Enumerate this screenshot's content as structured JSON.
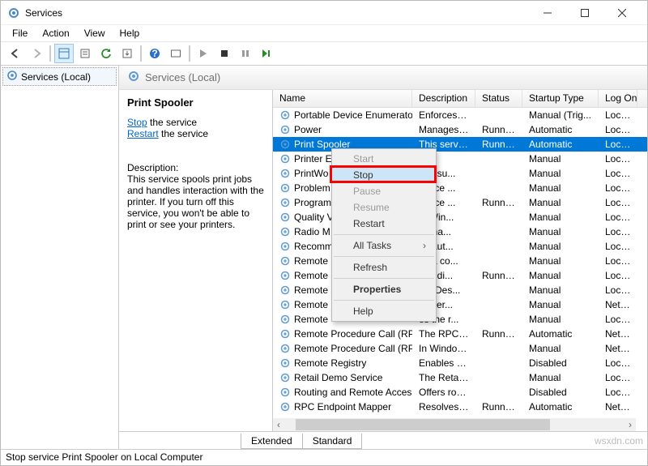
{
  "window": {
    "title": "Services"
  },
  "menu": {
    "items": [
      "File",
      "Action",
      "View",
      "Help"
    ]
  },
  "nav": {
    "label": "Services (Local)"
  },
  "content_header": {
    "title": "Services (Local)"
  },
  "detail": {
    "name": "Print Spooler",
    "stop_label": "Stop",
    "stop_suffix": " the service",
    "restart_label": "Restart",
    "restart_suffix": " the service",
    "desc_label": "Description:",
    "desc_text": "This service spools print jobs and handles interaction with the printer. If you turn off this service, you won't be able to print or see your printers."
  },
  "columns": [
    "Name",
    "Description",
    "Status",
    "Startup Type",
    "Log On"
  ],
  "rows": [
    {
      "name": "Portable Device Enumerator...",
      "desc": "Enforces gr...",
      "status": "",
      "startup": "Manual (Trig...",
      "logon": "Local Sy"
    },
    {
      "name": "Power",
      "desc": "Manages p...",
      "status": "Running",
      "startup": "Automatic",
      "logon": "Local Sy"
    },
    {
      "name": "Print Spooler",
      "desc": "This service ...",
      "status": "Running",
      "startup": "Automatic",
      "logon": "Local Sy",
      "selected": true
    },
    {
      "name": "Printer E",
      "desc": "",
      "status": "",
      "startup": "Manual",
      "logon": "Local Sy"
    },
    {
      "name": "PrintWo",
      "desc": "des su...",
      "status": "",
      "startup": "Manual",
      "logon": "Local Sy"
    },
    {
      "name": "Problem",
      "desc": "ervice ...",
      "status": "",
      "startup": "Manual",
      "logon": "Local Sy"
    },
    {
      "name": "Program",
      "desc": "ervice ...",
      "status": "Running",
      "startup": "Manual",
      "logon": "Local Sy"
    },
    {
      "name": "Quality V",
      "desc": "ty Win...",
      "status": "",
      "startup": "Manual",
      "logon": "Local Se"
    },
    {
      "name": "Radio M",
      "desc": "Mana...",
      "status": "",
      "startup": "Manual",
      "logon": "Local Se"
    },
    {
      "name": "Recomm",
      "desc": "es aut...",
      "status": "",
      "startup": "Manual",
      "logon": "Local Sy"
    },
    {
      "name": "Remote",
      "desc": "es a co...",
      "status": "",
      "startup": "Manual",
      "logon": "Local Sy"
    },
    {
      "name": "Remote",
      "desc": "ges di...",
      "status": "Running",
      "startup": "Manual",
      "logon": "Local Sy"
    },
    {
      "name": "Remote",
      "desc": "ote Des...",
      "status": "",
      "startup": "Manual",
      "logon": "Local Sy"
    },
    {
      "name": "Remote",
      "desc": "s user...",
      "status": "",
      "startup": "Manual",
      "logon": "Networ"
    },
    {
      "name": "Remote",
      "desc": "es the r...",
      "status": "",
      "startup": "Manual",
      "logon": "Local Sy"
    },
    {
      "name": "Remote Procedure Call (RPC)",
      "desc": "The RPCSS s...",
      "status": "Running",
      "startup": "Automatic",
      "logon": "Networ"
    },
    {
      "name": "Remote Procedure Call (RP...",
      "desc": "In Windows...",
      "status": "",
      "startup": "Manual",
      "logon": "Networ"
    },
    {
      "name": "Remote Registry",
      "desc": "Enables rem...",
      "status": "",
      "startup": "Disabled",
      "logon": "Local Se"
    },
    {
      "name": "Retail Demo Service",
      "desc": "The Retail D...",
      "status": "",
      "startup": "Manual",
      "logon": "Local Sy"
    },
    {
      "name": "Routing and Remote Access",
      "desc": "Offers routi...",
      "status": "",
      "startup": "Disabled",
      "logon": "Local Sy"
    },
    {
      "name": "RPC Endpoint Mapper",
      "desc": "Resolves RP...",
      "status": "Running",
      "startup": "Automatic",
      "logon": "Networ"
    }
  ],
  "context_menu": [
    {
      "label": "Start",
      "disabled": true
    },
    {
      "label": "Stop",
      "hover": true
    },
    {
      "label": "Pause",
      "disabled": true
    },
    {
      "label": "Resume",
      "disabled": true
    },
    {
      "label": "Restart"
    },
    {
      "sep": true
    },
    {
      "label": "All Tasks",
      "arrow": true
    },
    {
      "sep": true
    },
    {
      "label": "Refresh"
    },
    {
      "sep": true
    },
    {
      "label": "Properties",
      "bold": true
    },
    {
      "sep": true
    },
    {
      "label": "Help"
    }
  ],
  "tabs": {
    "extended": "Extended",
    "standard": "Standard"
  },
  "status": "Stop service Print Spooler on Local Computer",
  "watermark": "wsxdn.com"
}
